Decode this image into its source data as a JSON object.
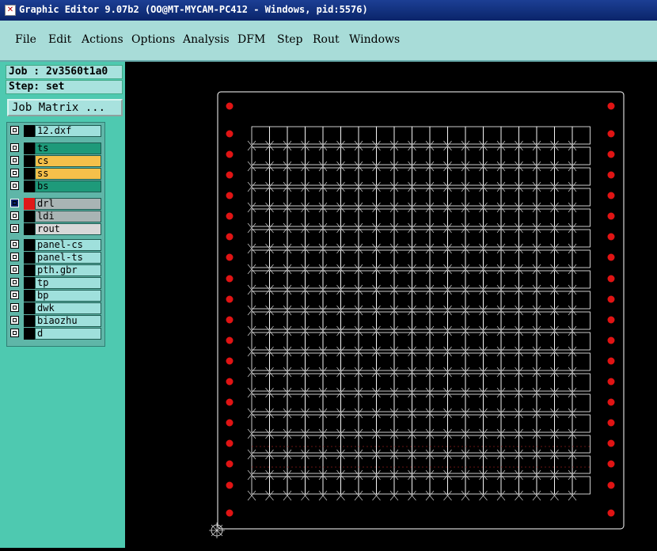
{
  "window": {
    "title": "Graphic Editor 9.07b2 (OO@MT-MYCAM-PC412 - Windows, pid:5576)"
  },
  "menu": [
    "File",
    "Edit",
    "Actions",
    "Options",
    "Analysis",
    "DFM",
    "Step",
    "Rout",
    "Windows"
  ],
  "job": {
    "job_label": "Job : 2v3560t1a0",
    "step_label": "Step: set",
    "matrix_button": "Job Matrix ..."
  },
  "layers": [
    {
      "name": "12.dxf",
      "color": "#9fe0dc",
      "swatch": "#000000",
      "active": false
    },
    {
      "name": "ts",
      "color": "#1e9a7a",
      "swatch": "#000000",
      "active": false
    },
    {
      "name": "cs",
      "color": "#f5c04a",
      "swatch": "#000000",
      "active": false
    },
    {
      "name": "ss",
      "color": "#f5c04a",
      "swatch": "#000000",
      "active": false
    },
    {
      "name": "bs",
      "color": "#1e9a7a",
      "swatch": "#000000",
      "active": false
    },
    {
      "name": "drl",
      "color": "#a9b4b4",
      "swatch": "#e01818",
      "active": true
    },
    {
      "name": "ldi",
      "color": "#a9b4b4",
      "swatch": "#000000",
      "active": false
    },
    {
      "name": "rout",
      "color": "#d8d8d8",
      "swatch": "#000000",
      "active": false
    },
    {
      "name": "panel-cs",
      "color": "#9fe0dc",
      "swatch": "#000000",
      "active": false
    },
    {
      "name": "panel-ts",
      "color": "#9fe0dc",
      "swatch": "#000000",
      "active": false
    },
    {
      "name": "pth.gbr",
      "color": "#9fe0dc",
      "swatch": "#000000",
      "active": false
    },
    {
      "name": "tp",
      "color": "#9fe0dc",
      "swatch": "#000000",
      "active": false
    },
    {
      "name": "bp",
      "color": "#9fe0dc",
      "swatch": "#000000",
      "active": false
    },
    {
      "name": "dwk",
      "color": "#9fe0dc",
      "swatch": "#000000",
      "active": false
    },
    {
      "name": "biaozhu",
      "color": "#9fe0dc",
      "swatch": "#000000",
      "active": false
    },
    {
      "name": "d",
      "color": "#9fe0dc",
      "swatch": "#000000",
      "active": false
    }
  ],
  "panel": {
    "columns": 19,
    "rows": 18,
    "tooling_holes_per_side": 20,
    "hole_color": "#e01414",
    "outline_color": "#ffffff"
  }
}
